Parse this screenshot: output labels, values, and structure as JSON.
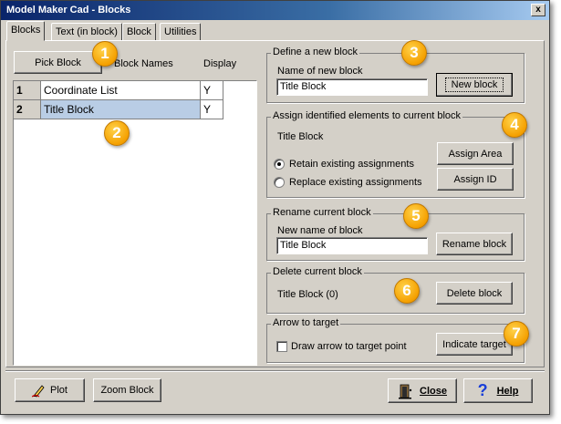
{
  "window": {
    "title": "Model Maker Cad - Blocks",
    "close_glyph": "x"
  },
  "tabs": [
    "Blocks",
    "Text (in block)",
    "Block",
    "Utilities"
  ],
  "left": {
    "pick_block": "Pick Block",
    "col_block_names": "Block Names",
    "col_display": "Display",
    "rows": [
      {
        "num": "1",
        "name": "Coordinate List",
        "display": "Y"
      },
      {
        "num": "2",
        "name": "Title Block",
        "display": "Y"
      }
    ]
  },
  "define": {
    "group_title": "Define a new block",
    "name_label": "Name of new block",
    "name_value": "Title Block",
    "new_block": "New block"
  },
  "assign": {
    "group_title": "Assign identified elements to current block",
    "current": "Title Block",
    "assign_area": "Assign Area",
    "assign_id": "Assign ID",
    "retain": "Retain existing assignments",
    "replace": "Replace existing assignments"
  },
  "rename": {
    "group_title": "Rename current block",
    "name_label": "New name of block",
    "name_value": "Title Block",
    "rename_btn": "Rename block"
  },
  "delete": {
    "group_title": "Delete current block",
    "current": "Title Block (0)",
    "delete_btn": "Delete block"
  },
  "arrow": {
    "group_title": "Arrow to target",
    "draw_label": "Draw arrow to target point",
    "indicate": "Indicate target"
  },
  "bottom": {
    "plot": "Plot",
    "zoom_block": "Zoom Block",
    "close": "Close",
    "help": "Help"
  },
  "badges": [
    "1",
    "2",
    "3",
    "4",
    "5",
    "6",
    "7"
  ],
  "colors": {
    "titlebar": "#0a246a",
    "dialog_bg": "#d4d0c8",
    "selected_row": "#b9cde5",
    "badge": "#f5a000"
  },
  "icons": {
    "plot": "pen-icon",
    "close": "door-exit-icon",
    "help": "question-icon"
  }
}
